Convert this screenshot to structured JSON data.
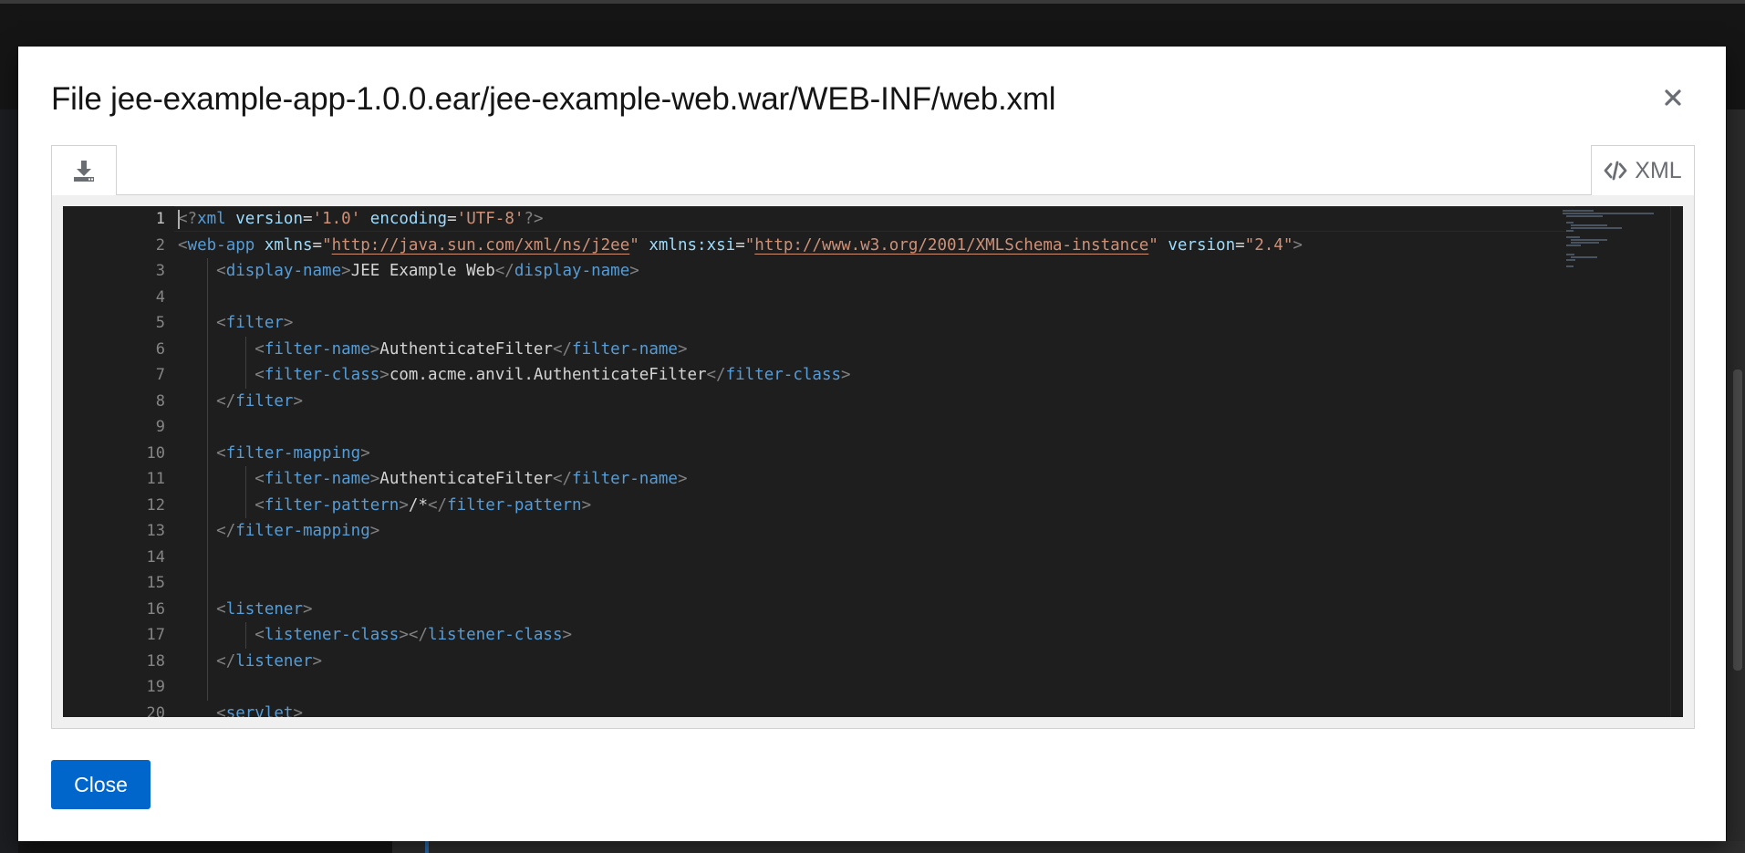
{
  "modal": {
    "title": "File jee-example-app-1.0.0.ear/jee-example-web.war/WEB-INF/web.xml",
    "close_icon": "close-icon",
    "close_button_label": "Close"
  },
  "toolbar": {
    "download_icon": "download-icon",
    "language_icon": "code-icon",
    "language_label": "XML"
  },
  "editor": {
    "active_line": 1,
    "line_numbers": [
      "1",
      "2",
      "3",
      "4",
      "5",
      "6",
      "7",
      "8",
      "9",
      "10",
      "11",
      "12",
      "13",
      "14",
      "15",
      "16",
      "17",
      "18",
      "19",
      "20"
    ],
    "lines": [
      "<?xml version='1.0' encoding='UTF-8'?>",
      "<web-app xmlns=\"http://java.sun.com/xml/ns/j2ee\" xmlns:xsi=\"http://www.w3.org/2001/XMLSchema-instance\" version=\"2.4\">",
      "    <display-name>JEE Example Web</display-name>",
      "",
      "    <filter>",
      "        <filter-name>AuthenticateFilter</filter-name>",
      "        <filter-class>com.acme.anvil.AuthenticateFilter</filter-class>",
      "    </filter>",
      "",
      "    <filter-mapping>",
      "        <filter-name>AuthenticateFilter</filter-name>",
      "        <filter-pattern>/*</filter-pattern>",
      "    </filter-mapping>",
      "",
      "",
      "    <listener>",
      "        <listener-class></listener-class>",
      "    </listener>",
      "",
      "    <servlet>"
    ]
  },
  "colors": {
    "primary_button": "#0066cc",
    "editor_bg": "#1e1e1e",
    "tag": "#569cd6",
    "attr": "#9cdcfe",
    "string": "#ce9178"
  }
}
